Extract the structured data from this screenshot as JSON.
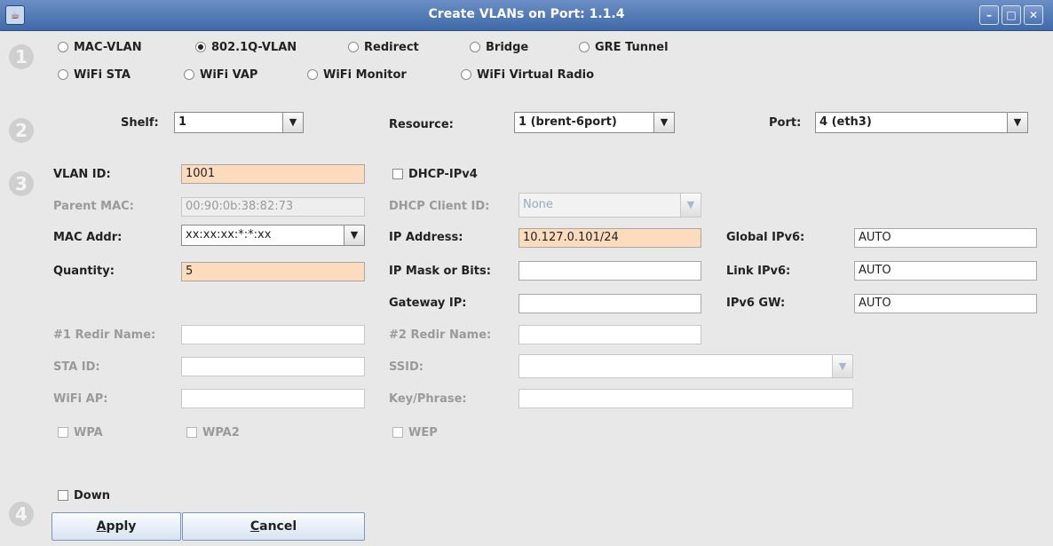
{
  "window": {
    "title": "Create VLANs on Port: 1.1.4",
    "minimize_glyph": "–",
    "maximize_glyph": "□",
    "close_glyph": "✕"
  },
  "steps": [
    "1",
    "2",
    "3",
    "4"
  ],
  "port_types": [
    {
      "label": "MAC-VLAN",
      "selected": false
    },
    {
      "label": "802.1Q-VLAN",
      "selected": true
    },
    {
      "label": "Redirect",
      "selected": false
    },
    {
      "label": "Bridge",
      "selected": false
    },
    {
      "label": "GRE Tunnel",
      "selected": false
    },
    {
      "label": "WiFi STA",
      "selected": false
    },
    {
      "label": "WiFi VAP",
      "selected": false
    },
    {
      "label": "WiFi Monitor",
      "selected": false
    },
    {
      "label": "WiFi Virtual Radio",
      "selected": false
    }
  ],
  "location": {
    "shelf_label": "Shelf:",
    "shelf_value": "1",
    "resource_label": "Resource:",
    "resource_value": "1 (brent-6port)",
    "port_label": "Port:",
    "port_value": "4 (eth3)"
  },
  "config": {
    "vlan_id_label": "VLAN ID:",
    "vlan_id_value": "1001",
    "parent_mac_label": "Parent MAC:",
    "parent_mac_value": "00:90:0b:38:82:73",
    "mac_addr_label": "MAC Addr:",
    "mac_addr_value": "xx:xx:xx:*:*:xx",
    "quantity_label": "Quantity:",
    "quantity_value": "5",
    "dhcp_ipv4_label": "DHCP-IPv4",
    "dhcp_client_id_label": "DHCP Client ID:",
    "dhcp_client_id_value": "None",
    "ip_address_label": "IP Address:",
    "ip_address_value": "10.127.0.101/24",
    "ip_mask_label": "IP Mask or Bits:",
    "ip_mask_value": "",
    "gateway_ip_label": "Gateway IP:",
    "gateway_ip_value": "",
    "global_ipv6_label": "Global IPv6:",
    "global_ipv6_value": "AUTO",
    "link_ipv6_label": "Link IPv6:",
    "link_ipv6_value": "AUTO",
    "ipv6_gw_label": "IPv6 GW:",
    "ipv6_gw_value": "AUTO",
    "redir1_label": "#1 Redir Name:",
    "redir1_value": "",
    "redir2_label": "#2 Redir Name:",
    "redir2_value": "",
    "sta_id_label": "STA ID:",
    "sta_id_value": "",
    "ssid_label": "SSID:",
    "ssid_value": "",
    "wifi_ap_label": "WiFi AP:",
    "wifi_ap_value": "",
    "key_label": "Key/Phrase:",
    "key_value": "",
    "wpa_label": "WPA",
    "wpa2_label": "WPA2",
    "wep_label": "WEP"
  },
  "down_label": "Down",
  "buttons": {
    "apply_mnemonic": "A",
    "apply_rest": "pply",
    "cancel_mnemonic": "C",
    "cancel_rest": "ancel"
  },
  "colors": {
    "title_bar": "#3f69a8",
    "required_field": "#fddcbd"
  }
}
